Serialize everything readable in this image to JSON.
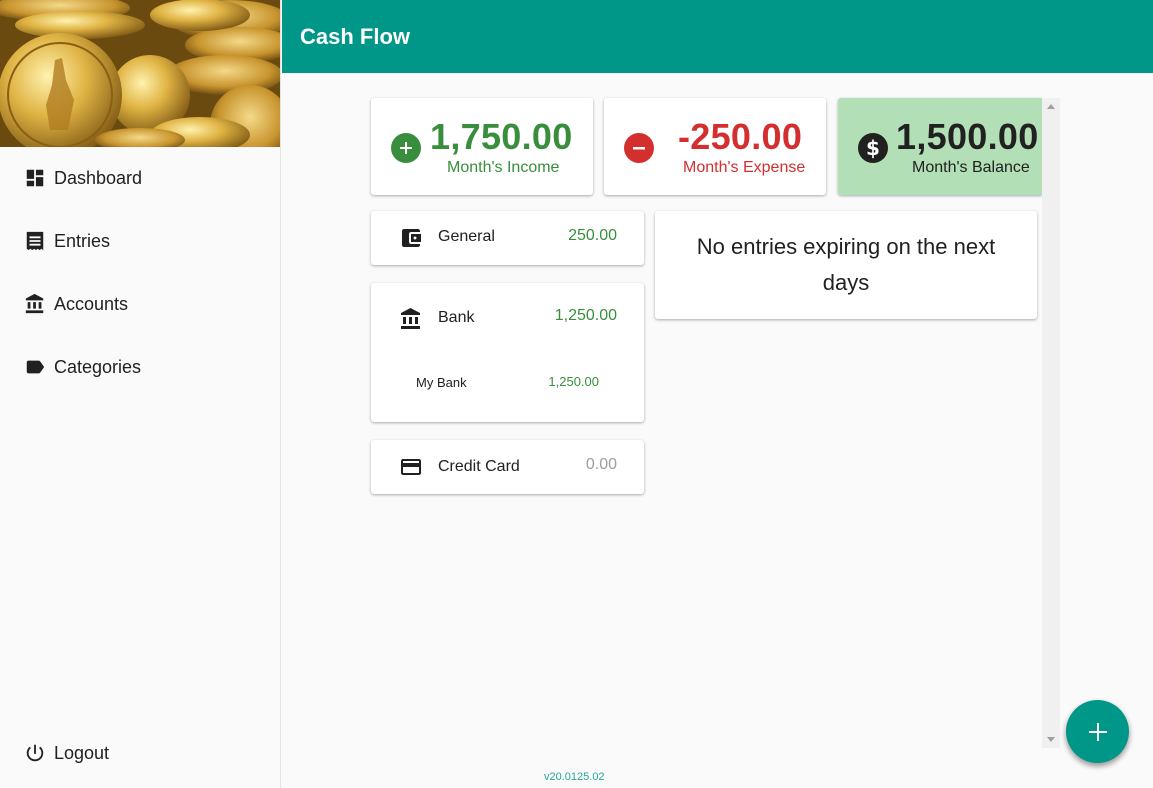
{
  "app": {
    "title": "Cash Flow",
    "version": "v20.0125.02"
  },
  "sidebar": {
    "items": [
      {
        "label": "Dashboard",
        "icon": "dashboard-icon"
      },
      {
        "label": "Entries",
        "icon": "entries-icon"
      },
      {
        "label": "Accounts",
        "icon": "bank-icon"
      },
      {
        "label": "Categories",
        "icon": "label-icon"
      }
    ],
    "logout": {
      "label": "Logout",
      "icon": "power-icon"
    }
  },
  "summary": {
    "income": {
      "value": "1,750.00",
      "label": "Month's Income",
      "color": "#388e3c"
    },
    "expense": {
      "value": "-250.00",
      "label": "Month's Expense",
      "color": "#d32f2f"
    },
    "balance": {
      "value": "1,500.00",
      "label": "Month's Balance",
      "color": "#212121",
      "background": "#b2dfb5"
    }
  },
  "accounts": [
    {
      "name": "General",
      "amount": "250.00",
      "icon": "wallet-icon",
      "color": "#388e3c"
    },
    {
      "name": "Bank",
      "amount": "1,250.00",
      "icon": "bank-icon",
      "color": "#388e3c",
      "sub": [
        {
          "name": "My Bank",
          "amount": "1,250.00"
        }
      ]
    },
    {
      "name": "Credit Card",
      "amount": "0.00",
      "icon": "credit-card-icon",
      "color": "#9e9e9e"
    }
  ],
  "expiring": {
    "message": "No entries expiring on the next days"
  }
}
